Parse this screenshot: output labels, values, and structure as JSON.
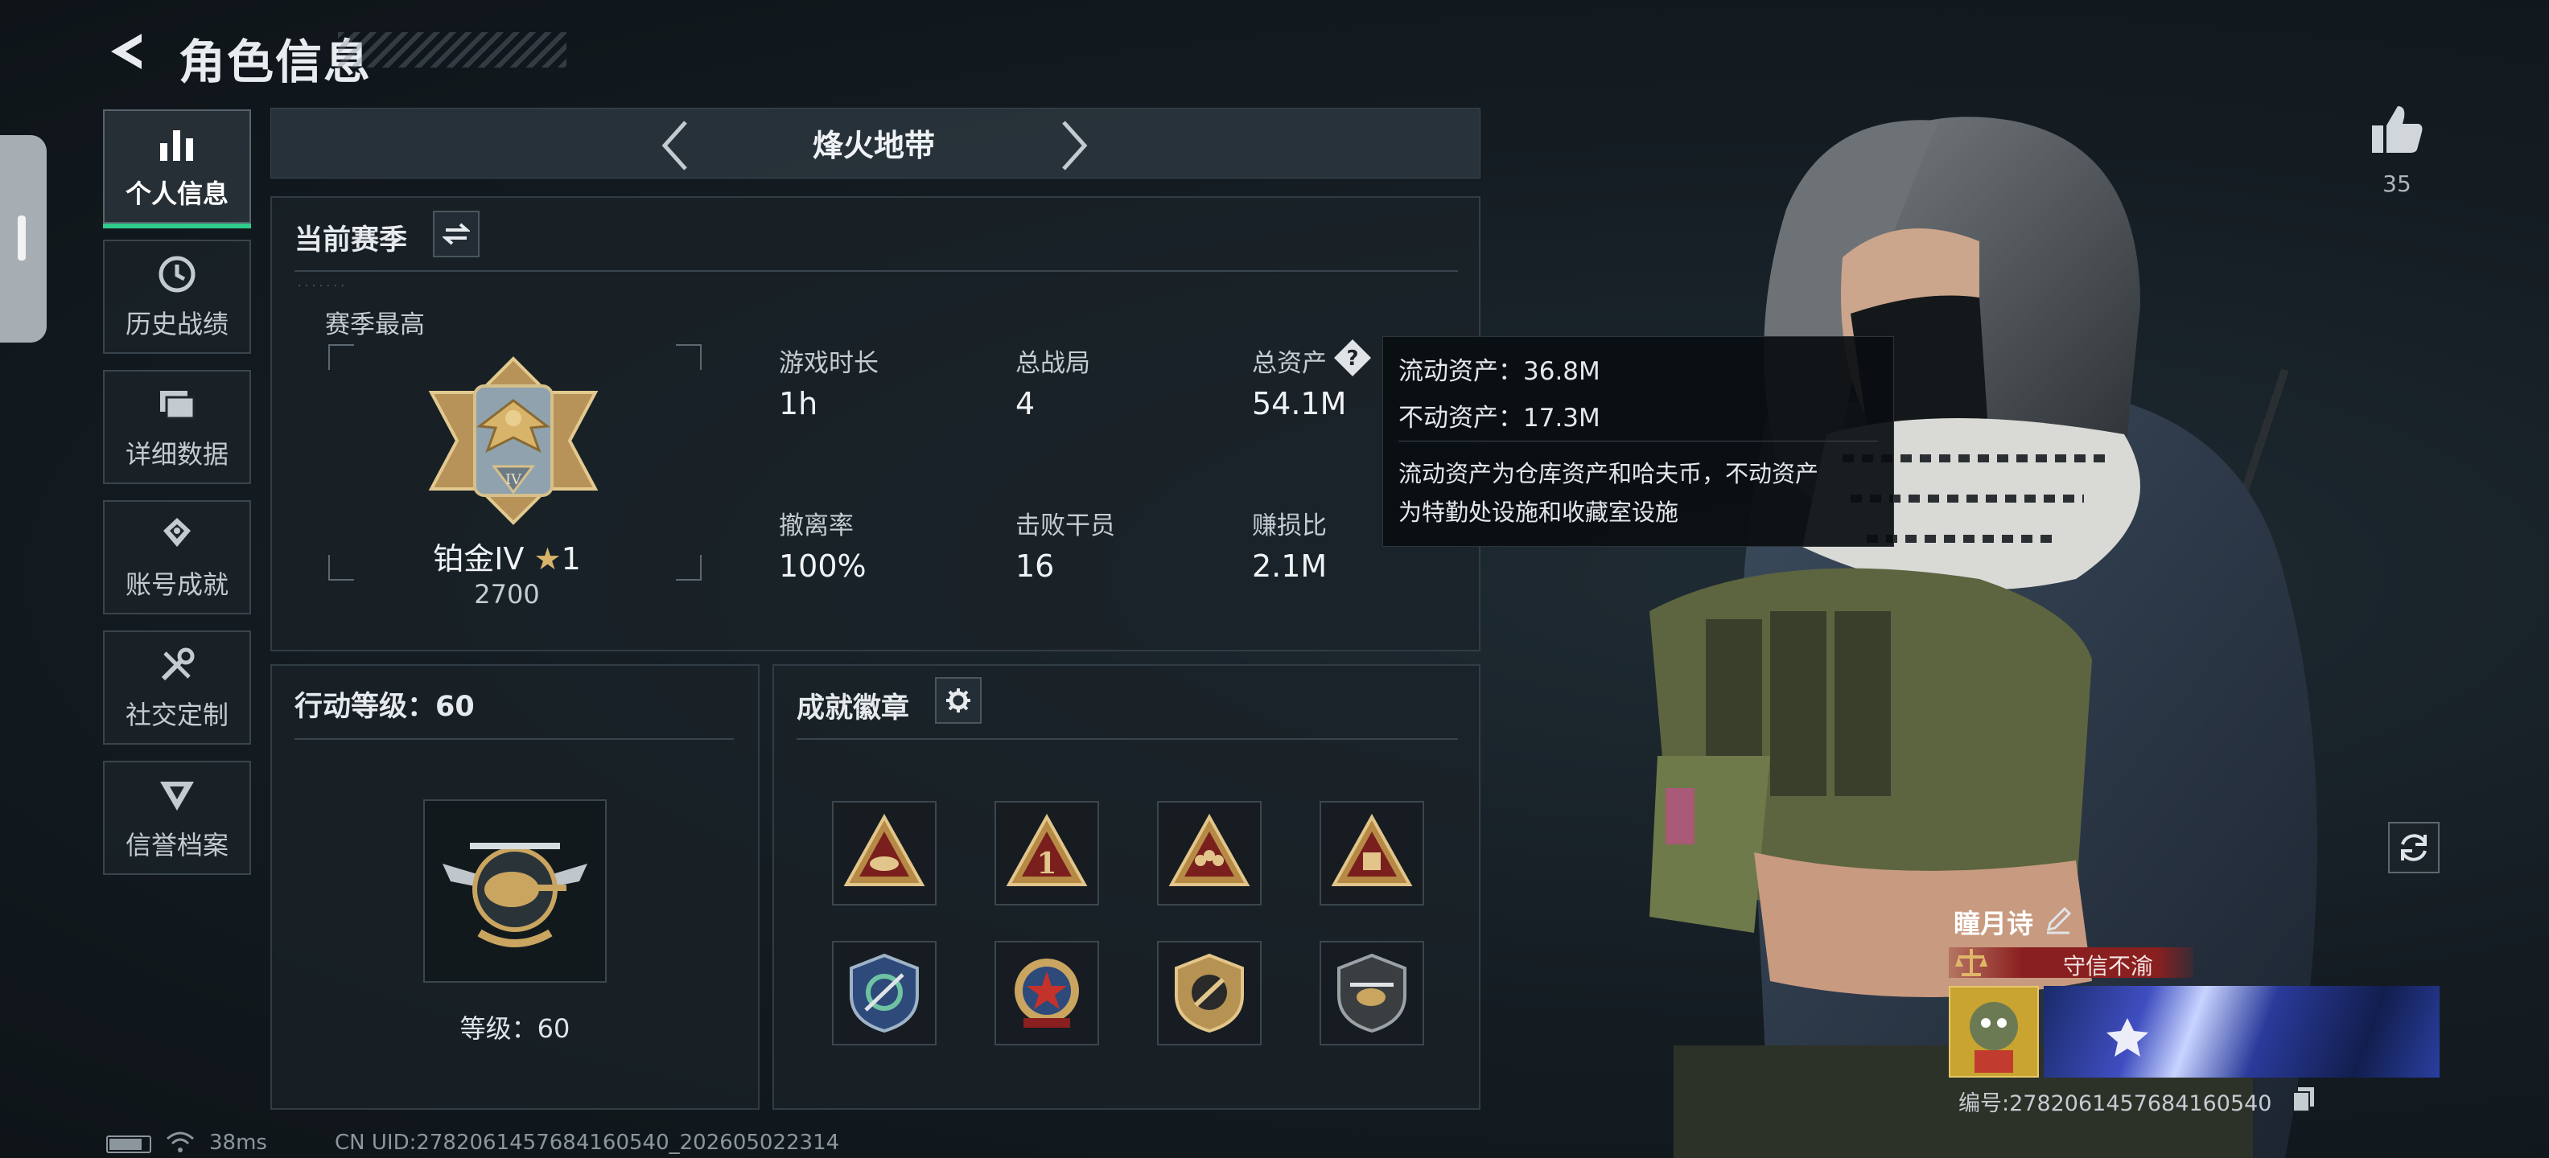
{
  "header": {
    "title": "角色信息"
  },
  "nav": {
    "items": [
      {
        "label": "个人信息",
        "icon": "bar-chart-icon"
      },
      {
        "label": "历史战绩",
        "icon": "history-icon"
      },
      {
        "label": "详细数据",
        "icon": "data-folder-icon"
      },
      {
        "label": "账号成就",
        "icon": "achievement-icon"
      },
      {
        "label": "社交定制",
        "icon": "tools-icon"
      },
      {
        "label": "信誉档案",
        "icon": "credit-badge-icon"
      }
    ]
  },
  "mode": {
    "title": "烽火地带"
  },
  "season": {
    "title": "当前赛季",
    "best_label": "赛季最高",
    "rank_name": "铂金IV",
    "rank_stars": "1",
    "rank_points": "2700",
    "stats": [
      {
        "label": "游戏时长",
        "value": "1h"
      },
      {
        "label": "总战局",
        "value": "4"
      },
      {
        "label": "总资产",
        "value": "54.1M"
      },
      {
        "label": "撤离率",
        "value": "100%"
      },
      {
        "label": "击败干员",
        "value": "16"
      },
      {
        "label": "赚损比",
        "value": "2.1M"
      }
    ]
  },
  "tooltip": {
    "line1": "流动资产：36.8M",
    "line2": "不动资产：17.3M",
    "desc1": "流动资产为仓库资产和哈夫币，不动资产",
    "desc2": "为特勤处设施和收藏室设施"
  },
  "level": {
    "title": "行动等级：60",
    "caption": "等级：60"
  },
  "badges": {
    "title": "成就徽章",
    "items": [
      {
        "icon": "ration-triangle-badge-icon"
      },
      {
        "icon": "number-one-triangle-badge-icon"
      },
      {
        "icon": "squad-triangle-badge-icon"
      },
      {
        "icon": "crate-triangle-badge-icon"
      },
      {
        "icon": "crossed-arrows-shield-badge-icon"
      },
      {
        "icon": "star-medal-badge-icon"
      },
      {
        "icon": "no-weapon-shield-badge-icon"
      },
      {
        "icon": "helicopter-shield-badge-icon"
      }
    ]
  },
  "profile": {
    "likes": "35",
    "player_name": "瞳月诗",
    "title_tag": "守信不渝",
    "id_text": "编号:2782061457684160540"
  },
  "status": {
    "ping": "38ms",
    "uid": "CN UID:2782061457684160540_202605022314"
  },
  "colors": {
    "accent_green": "#2fcc8c",
    "title_tag_red": "#8a1f1f",
    "rank_gold": "#c79a48"
  }
}
